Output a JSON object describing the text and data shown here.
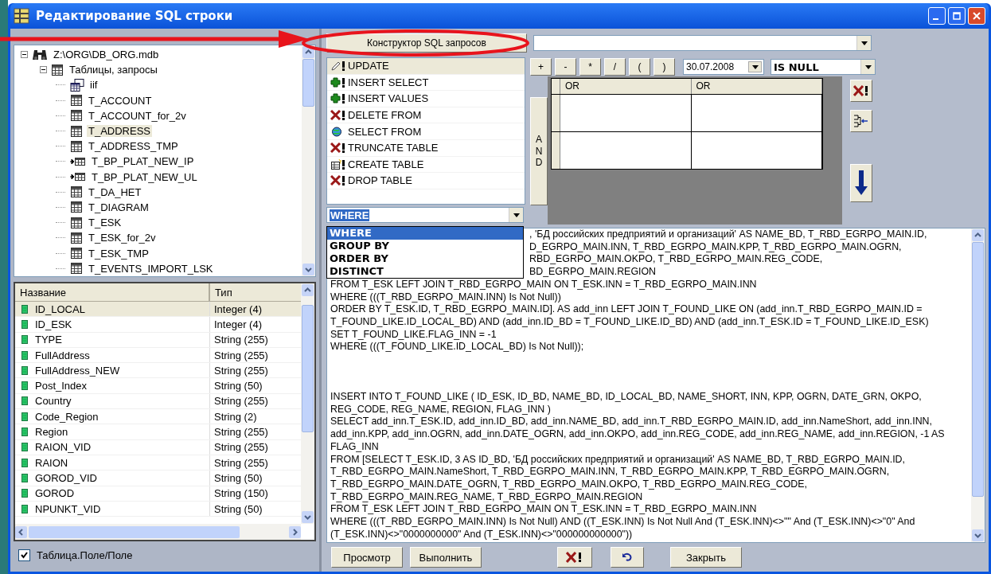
{
  "window": {
    "title": "Редактирование SQL строки"
  },
  "tree": [
    {
      "label": "Z:\\ORG\\DB_ORG.mdb",
      "kind": "database",
      "expanded": true,
      "selected": false,
      "children": [
        {
          "label": "Таблицы, запросы",
          "kind": "group",
          "expanded": true,
          "selected": false,
          "children": [
            {
              "label": "iif",
              "kind": "query",
              "selected": false
            },
            {
              "label": "T_ACCOUNT",
              "kind": "table",
              "selected": false
            },
            {
              "label": "T_ACCOUNT_for_2v",
              "kind": "table",
              "selected": false
            },
            {
              "label": "T_ADDRESS",
              "kind": "table",
              "selected": true
            },
            {
              "label": "T_ADDRESS_TMP",
              "kind": "table",
              "selected": false
            },
            {
              "label": "T_BP_PLAT_NEW_IP",
              "kind": "linked",
              "selected": false
            },
            {
              "label": "T_BP_PLAT_NEW_UL",
              "kind": "linked",
              "selected": false
            },
            {
              "label": "T_DA_HET",
              "kind": "table",
              "selected": false
            },
            {
              "label": "T_DIAGRAM",
              "kind": "table",
              "selected": false
            },
            {
              "label": "T_ESK",
              "kind": "table",
              "selected": false
            },
            {
              "label": "T_ESK_for_2v",
              "kind": "table",
              "selected": false
            },
            {
              "label": "T_ESK_TMP",
              "kind": "table",
              "selected": false
            },
            {
              "label": "T_EVENTS_IMPORT_LSK",
              "kind": "table",
              "selected": false
            }
          ]
        }
      ]
    }
  ],
  "fields": {
    "columns": [
      "Название",
      "Тип"
    ],
    "rows": [
      {
        "name": "ID_LOCAL",
        "type": "Integer (4)",
        "selected": true
      },
      {
        "name": "ID_ESK",
        "type": "Integer (4)",
        "selected": false
      },
      {
        "name": "TYPE",
        "type": "String (255)",
        "selected": false
      },
      {
        "name": "FullAddress",
        "type": "String (255)",
        "selected": false
      },
      {
        "name": "FullAddress_NEW",
        "type": "String (255)",
        "selected": false
      },
      {
        "name": "Post_Index",
        "type": "String (50)",
        "selected": false
      },
      {
        "name": "Country",
        "type": "String (255)",
        "selected": false
      },
      {
        "name": "Code_Region",
        "type": "String (2)",
        "selected": false
      },
      {
        "name": "Region",
        "type": "String (255)",
        "selected": false
      },
      {
        "name": "RAION_VID",
        "type": "String (255)",
        "selected": false
      },
      {
        "name": "RAION",
        "type": "String (255)",
        "selected": false
      },
      {
        "name": "GOROD_VID",
        "type": "String (50)",
        "selected": false
      },
      {
        "name": "GOROD",
        "type": "String (150)",
        "selected": false
      },
      {
        "name": "NPUNKT_VID",
        "type": "String (50)",
        "selected": false
      }
    ]
  },
  "qualified_names": {
    "label": "Таблица.Поле/Поле",
    "checked": true
  },
  "constructor_button": "Конструктор SQL запросов",
  "commands": [
    {
      "label": "UPDATE",
      "kind": "update",
      "selected": true
    },
    {
      "label": "INSERT SELECT",
      "kind": "insert",
      "selected": false
    },
    {
      "label": "INSERT VALUES",
      "kind": "insert",
      "selected": false
    },
    {
      "label": "DELETE FROM",
      "kind": "delete",
      "selected": false
    },
    {
      "label": "SELECT FROM",
      "kind": "select",
      "selected": false
    },
    {
      "label": "TRUNCATE TABLE",
      "kind": "delete",
      "selected": false
    },
    {
      "label": "CREATE TABLE",
      "kind": "create",
      "selected": false
    },
    {
      "label": "DROP TABLE",
      "kind": "delete",
      "selected": false
    }
  ],
  "operators": [
    "+",
    "-",
    "*",
    "/",
    "(",
    ")"
  ],
  "date_combo": {
    "value": "30.07.2008"
  },
  "condition_combo": {
    "value": "IS NULL"
  },
  "and_button": "AND",
  "grid": {
    "columns": [
      "OR",
      "OR"
    ]
  },
  "side_tools": [
    {
      "kind": "clear"
    },
    {
      "kind": "join"
    },
    {
      "kind": "arrow-down"
    }
  ],
  "clause_combo": {
    "value": "WHERE",
    "options": [
      {
        "label": "WHERE",
        "selected": true
      },
      {
        "label": "GROUP BY",
        "selected": false
      },
      {
        "label": "ORDER BY",
        "selected": false
      },
      {
        "label": "DISTINCT",
        "selected": false
      }
    ]
  },
  "sql": {
    "overlapped_lines": [
      ", 'БД российских предприятий и организаций' AS NAME_BD, T_RBD_EGRPO_MAIN.ID,",
      "D_EGRPO_MAIN.INN, T_RBD_EGRPO_MAIN.KPP, T_RBD_EGRPO_MAIN.OGRN,",
      "RBD_EGRPO_MAIN.OKPO, T_RBD_EGRPO_MAIN.REG_CODE,",
      "BD_EGRPO_MAIN.REGION"
    ],
    "blocks": [
      [
        "FROM T_ESK LEFT JOIN T_RBD_EGRPO_MAIN ON T_ESK.INN = T_RBD_EGRPO_MAIN.INN",
        "WHERE (((T_RBD_EGRPO_MAIN.INN) Is Not Null))",
        "ORDER BY T_ESK.ID, T_RBD_EGRPO_MAIN.ID]. AS add_inn LEFT JOIN T_FOUND_LIKE ON (add_inn.T_RBD_EGRPO_MAIN.ID =",
        "T_FOUND_LIKE.ID_LOCAL_BD) AND (add_inn.ID_BD = T_FOUND_LIKE.ID_BD) AND (add_inn.T_ESK.ID = T_FOUND_LIKE.ID_ESK)",
        "SET T_FOUND_LIKE.FLAG_INN = -1",
        "WHERE (((T_FOUND_LIKE.ID_LOCAL_BD) Is Not Null));"
      ],
      [
        "INSERT INTO T_FOUND_LIKE ( ID_ESK, ID_BD, NAME_BD, ID_LOCAL_BD, NAME_SHORT, INN, KPP, OGRN, DATE_GRN, OKPO,",
        "REG_CODE, REG_NAME, REGION, FLAG_INN )",
        "SELECT add_inn.T_ESK.ID, add_inn.ID_BD, add_inn.NAME_BD, add_inn.T_RBD_EGRPO_MAIN.ID, add_inn.NameShort, add_inn.INN,",
        "add_inn.KPP, add_inn.OGRN, add_inn.DATE_OGRN, add_inn.OKPO, add_inn.REG_CODE, add_inn.REG_NAME, add_inn.REGION, -1 AS",
        "FLAG_INN",
        "FROM [SELECT T_ESK.ID, 3 AS ID_BD, 'БД российских предприятий и организаций' AS NAME_BD, T_RBD_EGRPO_MAIN.ID,",
        "T_RBD_EGRPO_MAIN.NameShort, T_RBD_EGRPO_MAIN.INN, T_RBD_EGRPO_MAIN.KPP, T_RBD_EGRPO_MAIN.OGRN,",
        "T_RBD_EGRPO_MAIN.DATE_OGRN, T_RBD_EGRPO_MAIN.OKPO, T_RBD_EGRPO_MAIN.REG_CODE,",
        "T_RBD_EGRPO_MAIN.REG_NAME, T_RBD_EGRPO_MAIN.REGION",
        "FROM T_ESK LEFT JOIN T_RBD_EGRPO_MAIN ON T_ESK.INN = T_RBD_EGRPO_MAIN.INN",
        "WHERE (((T_RBD_EGRPO_MAIN.INN) Is Not Null) AND ((T_ESK.INN) Is Not Null And (T_ESK.INN)<>\"\" And (T_ESK.INN)<>\"0\" And",
        "(T_ESK.INN)<>\"0000000000\" And (T_ESK.INN)<>\"000000000000\"))"
      ]
    ]
  },
  "buttons": [
    {
      "label": "Просмотр",
      "kind": "text"
    },
    {
      "label": "Выполнить",
      "kind": "text"
    },
    {
      "kind": "clear"
    },
    {
      "kind": "undo"
    },
    {
      "label": "Закрыть",
      "kind": "text"
    }
  ]
}
